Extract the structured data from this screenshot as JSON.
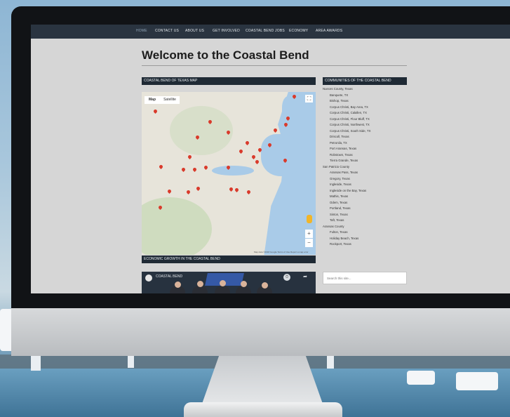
{
  "nav": {
    "items": [
      "HOME",
      "CONTACT US",
      "ABOUT US",
      "GET INVOLVED",
      "COASTAL BEND JOBS",
      "ECONOMY",
      "AREA AWARDS"
    ]
  },
  "page": {
    "title": "Welcome to the Coastal Bend"
  },
  "map_section": {
    "title": "COASTAL BEND OF TEXAS MAP",
    "tab_map": "Map",
    "tab_satellite": "Satellite",
    "attribution": "Map data ©2018 Google   Terms of Use   Report a map error"
  },
  "video_section": {
    "title": "ECONOMIC GROWTH IN THE COASTAL BEND",
    "video_title": "COASTAL BEND"
  },
  "communities": {
    "title": "COMMUNITIES OF THE COASTAL BEND",
    "groups": [
      {
        "name": "Nueces County, Texas",
        "items": [
          "Banquete, TX",
          "Bishop, Texas",
          "Corpus Christi, Bay Area, TX",
          "Corpus Christi, Calallen, TX",
          "Corpus Christi, Flour Bluff, TX",
          "Corpus Christi, Northwest, TX",
          "Corpus Christi, South Side, TX",
          "Driscoll, Texas",
          "Petronila, TX",
          "Port Aransas, Texas",
          "Robstown, Texas",
          "Tierra Grande, Texas"
        ]
      },
      {
        "name": "San Patricio County",
        "items": [
          "Aransas Pass, Texas",
          "Gregory, Texas",
          "Ingleside, Texas",
          "Ingleside on the Bay, Texas",
          "Mathis, Texas",
          "Odem, Texas",
          "Portland, Texas",
          "Sinton, Texas",
          "Taft, Texas"
        ]
      },
      {
        "name": "Aransas County",
        "items": [
          "Fulton, Texas",
          "Holiday Beach, Texas",
          "Rockport, Texas"
        ]
      }
    ]
  },
  "search": {
    "placeholder": "Search this site..."
  },
  "colors": {
    "navbar": "#2a3440",
    "page_bg": "#d6d6d6",
    "pin": "#d93a2b"
  }
}
